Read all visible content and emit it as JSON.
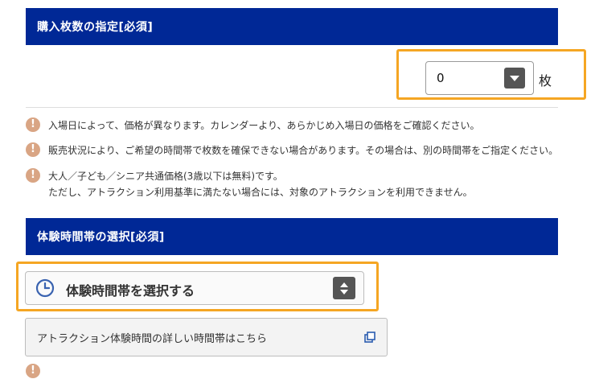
{
  "section1": {
    "header": "購入枚数の指定[必須]",
    "quantity": {
      "value": "0",
      "unit": "枚"
    }
  },
  "notes": [
    {
      "icon": "exclamation-icon",
      "text": "入場日によって、価格が異なります。カレンダーより、あらかじめ入場日の価格をご確認ください。"
    },
    {
      "icon": "exclamation-icon",
      "text": "販売状況により、ご希望の時間帯で枚数を確保できない場合があります。その場合は、別の時間帯をご指定ください。"
    },
    {
      "icon": "exclamation-icon",
      "line1": "大人／子ども／シニア共通価格(3歳以下は無料)です。",
      "line2": "ただし、アトラクション利用基準に満たない場合には、対象のアトラクションを利用できません。"
    }
  ],
  "section2": {
    "header": "体験時間帯の選択[必須]",
    "select_label": "体験時間帯を選択する",
    "detail_link": "アトラクション体験時間の詳しい時間帯はこちら"
  },
  "colors": {
    "header_bg": "#002896",
    "highlight": "#f5a623",
    "note_icon": "#d9a584",
    "clock": "#3a63b0",
    "link_icon": "#2a5db0"
  },
  "mark_glyph": "!"
}
